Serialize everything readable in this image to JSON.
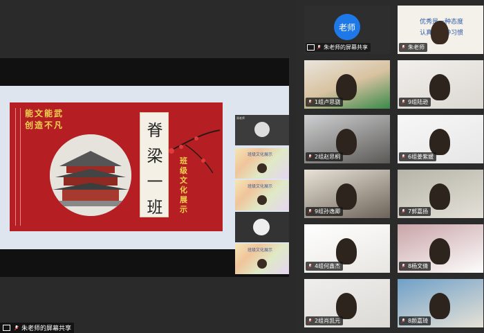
{
  "screen_share": {
    "slide": {
      "poem_line_1": "能文能武",
      "poem_line_2": "创造不凡",
      "title": "脊梁一班",
      "subtitle": "班级文化展示"
    },
    "filmstrip": {
      "label_top": "周老师",
      "tile_text_1": "班级文化展示",
      "tile_text_2": "班级文化展示",
      "tile_text_3": "班级文化展示"
    },
    "footer_label": "朱老师的屏幕共享",
    "colors": {
      "slide_red": "#b51f24",
      "accent_yellow": "#f3d34f"
    }
  },
  "participants": [
    {
      "name": "朱老师的屏幕共享",
      "type": "screen-share-avatar",
      "avatar_text": "老师",
      "icon": "screen-share-icon"
    },
    {
      "name": "朱老师",
      "type": "video",
      "board_text_1": "优秀是一种态度",
      "board_text_2": "认真是一种习惯",
      "icon": "person-icon"
    },
    {
      "name": "1组卢思骁",
      "type": "video"
    },
    {
      "name": "9组陆逊",
      "type": "video"
    },
    {
      "name": "2组赵思桐",
      "type": "video"
    },
    {
      "name": "6组姜紫媛",
      "type": "video"
    },
    {
      "name": "9组孙逸卿",
      "type": "video"
    },
    {
      "name": "7郭嘉扬",
      "type": "video"
    },
    {
      "name": "4组何鑫杰",
      "type": "video"
    },
    {
      "name": "8杨文倩",
      "type": "video"
    },
    {
      "name": "2组肖凯元",
      "type": "video"
    },
    {
      "name": "8颜嘉琦",
      "type": "video"
    }
  ],
  "icons": [
    "mic-icon",
    "screen-share-icon",
    "person-icon"
  ]
}
